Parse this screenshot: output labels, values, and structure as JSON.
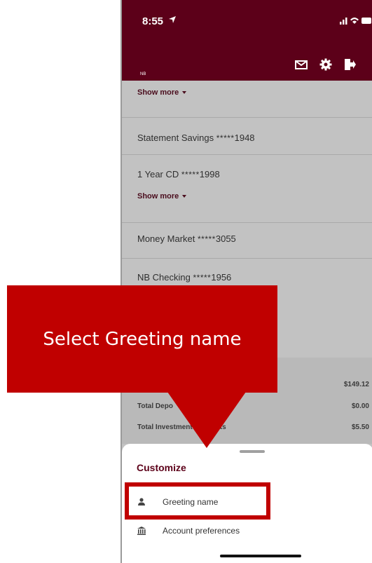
{
  "status_bar": {
    "time": "8:55"
  },
  "app_header": {
    "logo_text": "NB"
  },
  "accounts": {
    "show_more_label": "Show more",
    "rows": [
      {
        "name": "Statement Savings",
        "mask": "*****",
        "number": "1948"
      },
      {
        "name": "1 Year CD",
        "mask": "*****",
        "number": "1998"
      },
      {
        "name": "Money Market",
        "mask": "*****",
        "number": "3055"
      },
      {
        "name": "NB Checking",
        "mask": "*****",
        "number": "1956"
      }
    ]
  },
  "totals": {
    "items": [
      {
        "label": "",
        "value": "$149.12"
      },
      {
        "label": "Total Depo",
        "value": "$0.00"
      },
      {
        "label": "Total Investment Accounts",
        "value": "$5.50"
      }
    ]
  },
  "customize_sheet": {
    "title": "Customize",
    "items": [
      {
        "label": "Greeting name",
        "icon": "person-icon"
      },
      {
        "label": "Account preferences",
        "icon": "bank-icon"
      }
    ]
  },
  "callout": {
    "text": "Select Greeting name"
  },
  "colors": {
    "brand": "#5c0019",
    "callout": "#c00000"
  }
}
